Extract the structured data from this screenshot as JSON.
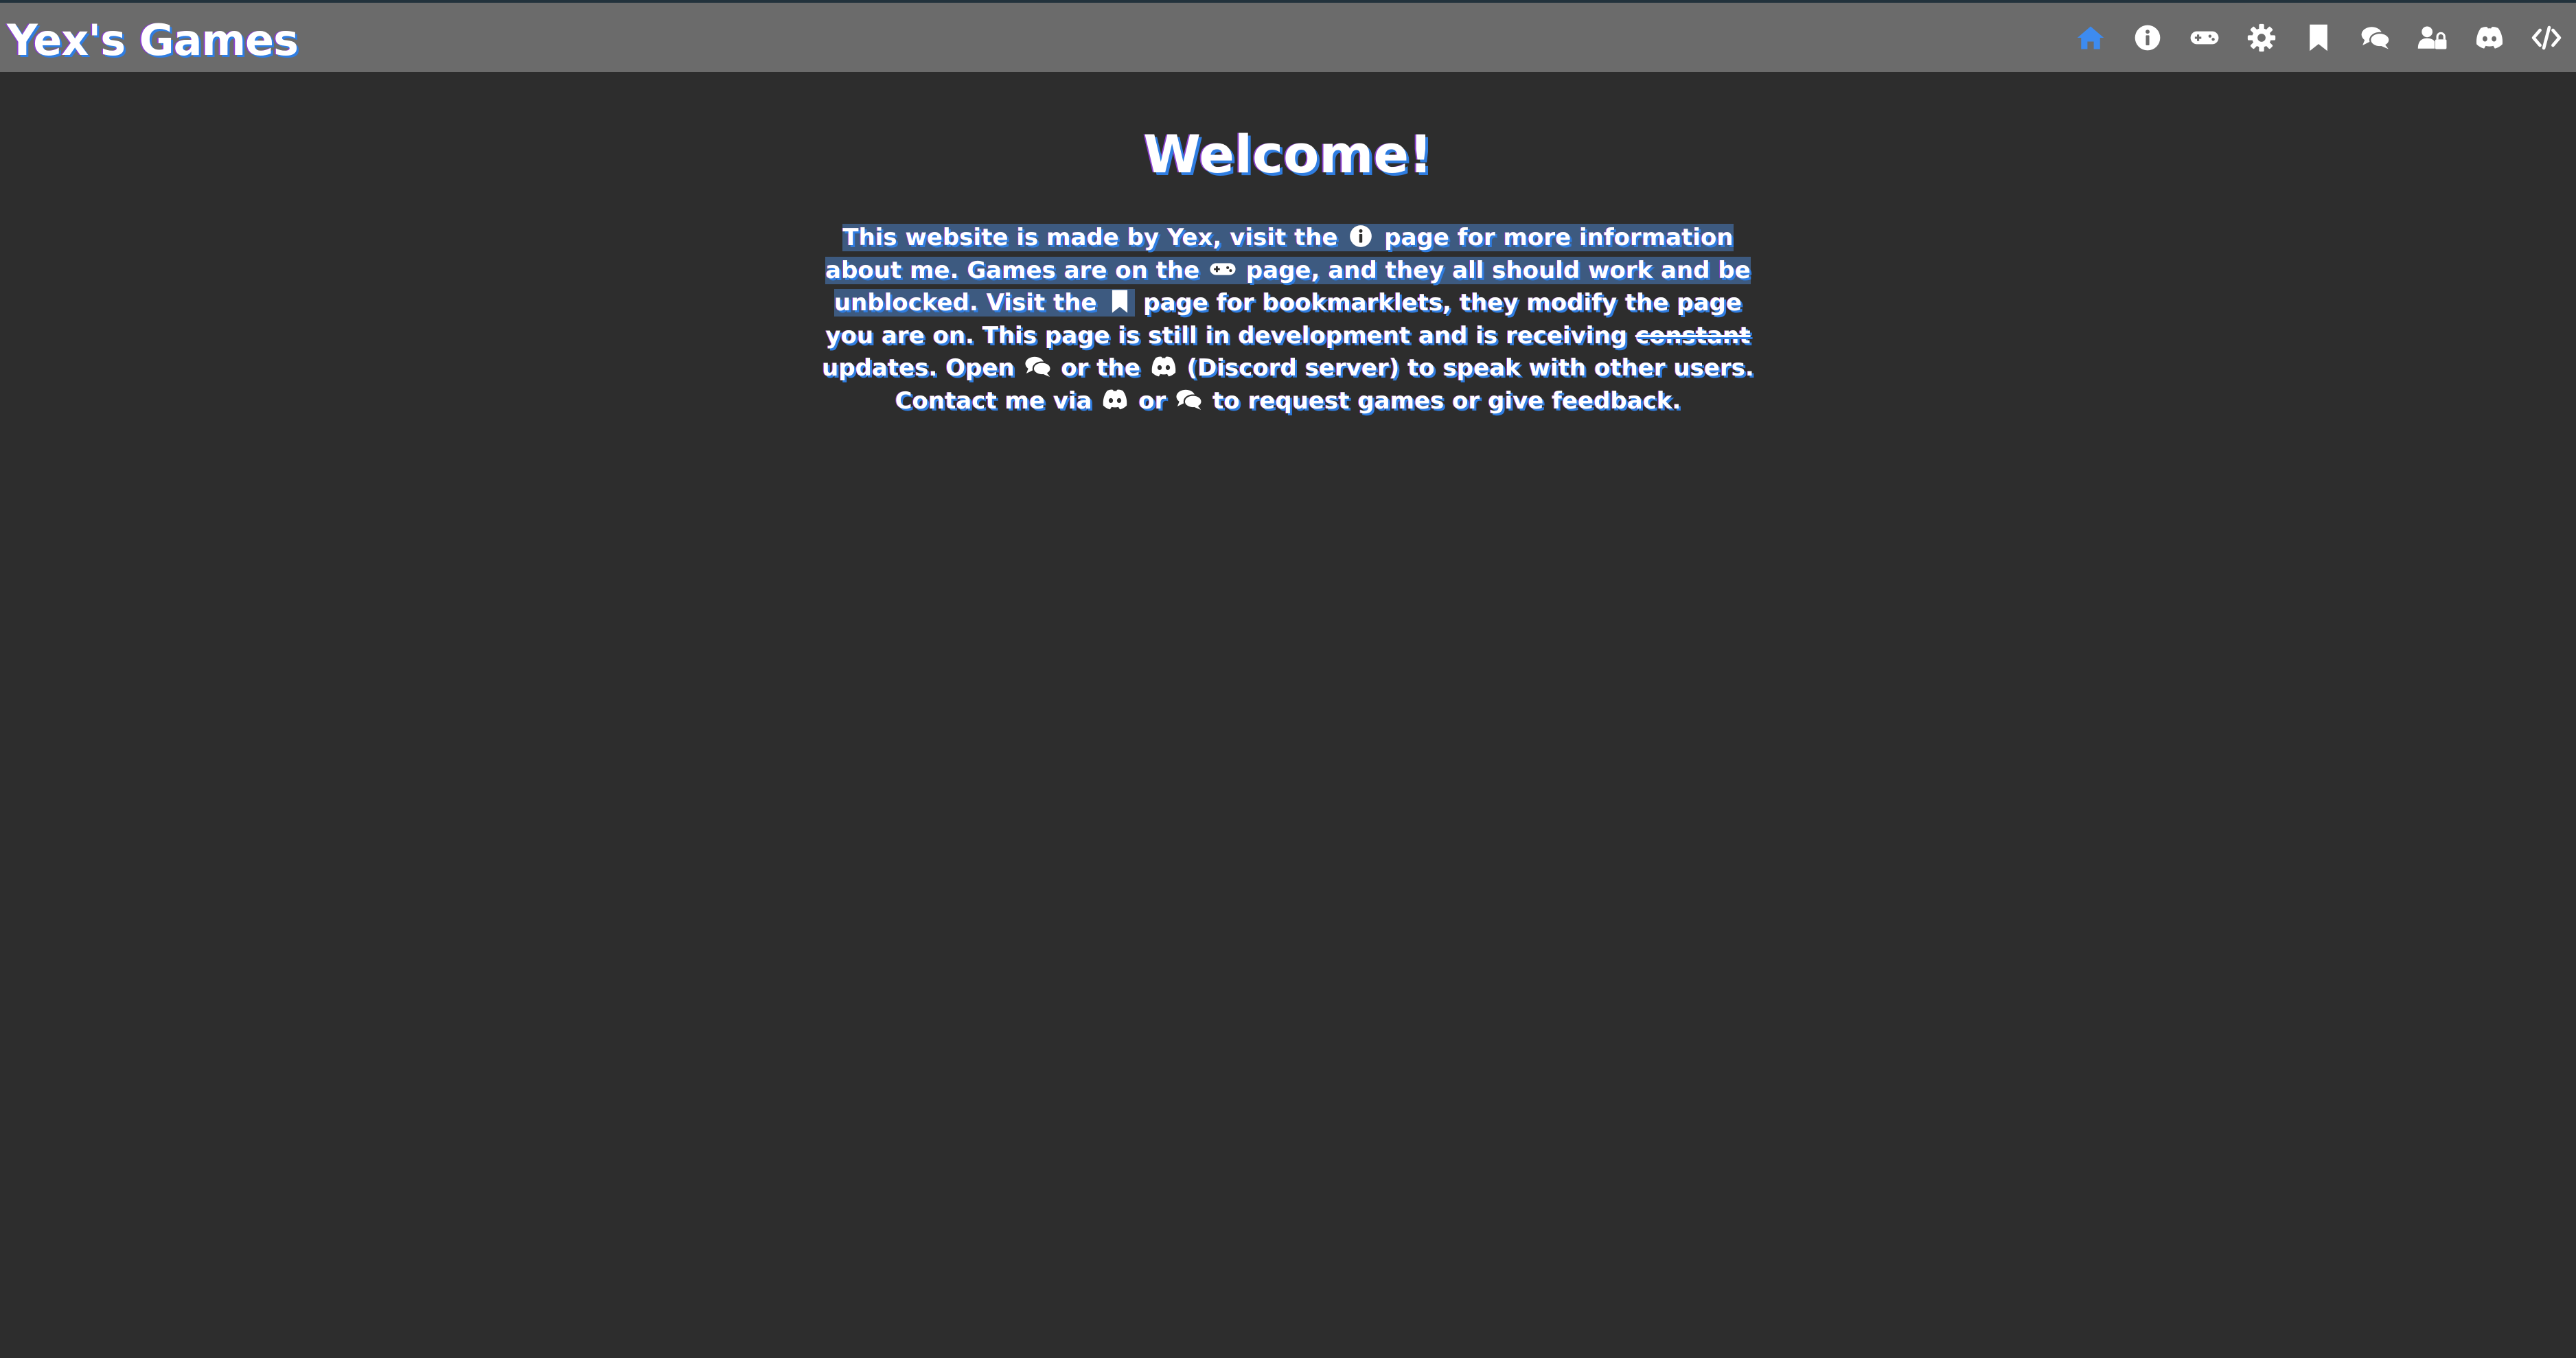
{
  "header": {
    "site_title": "Yex's Games",
    "nav": [
      {
        "name": "home-icon",
        "color": "#3d8bf0"
      },
      {
        "name": "info-icon",
        "color": "#ffffff"
      },
      {
        "name": "gamepad-icon",
        "color": "#ffffff"
      },
      {
        "name": "gear-icon",
        "color": "#ffffff"
      },
      {
        "name": "bookmark-icon",
        "color": "#ffffff"
      },
      {
        "name": "chat-icon",
        "color": "#ffffff"
      },
      {
        "name": "user-lock-icon",
        "color": "#ffffff"
      },
      {
        "name": "discord-icon",
        "color": "#ffffff"
      },
      {
        "name": "code-icon",
        "color": "#ffffff"
      }
    ]
  },
  "main": {
    "heading": "Welcome!",
    "intro": {
      "p1": "This website is made by ",
      "author": "Yex",
      "p2": ", visit the ",
      "p3": " page for more information about me. Games are on the ",
      "p4": " page, and they all should work and be unblocked. Visit the ",
      "p5": " page for bookmarklets, they modify the page you are on. This page is still in development and is receiving ",
      "strike": "constant",
      "p6": " updates. Open ",
      "p7": " or the ",
      "p8": " (Discord server) to speak with other users. Contact me via ",
      "p9": " or ",
      "p10": " to request games or give feedback."
    }
  },
  "colors": {
    "background": "#2d2d2d",
    "navbar": "#6b6b6b",
    "accent": "#3d8bf0",
    "selection": "#3d5a80"
  }
}
